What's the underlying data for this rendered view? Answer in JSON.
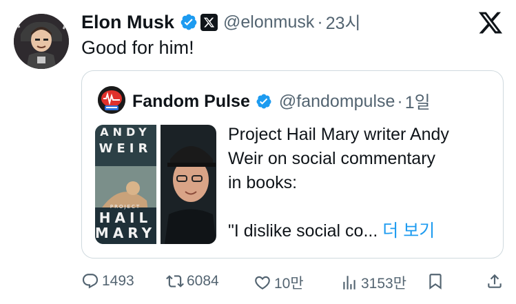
{
  "tweet": {
    "author_name": "Elon Musk",
    "handle": "@elonmusk",
    "separator": "·",
    "time": "23시",
    "text": "Good for him!"
  },
  "quote": {
    "author_name": "Fandom Pulse",
    "handle": "@fandompulse",
    "separator": "·",
    "time": "1일",
    "text_lines": [
      "Project Hail Mary writer Andy",
      "Weir on social commentary",
      "in books:"
    ],
    "text_continued": "\"I dislike social co...",
    "show_more": "더 보기",
    "media": {
      "book_cover_words": [
        "ANDY",
        "WEIR",
        "PROJECT",
        "HAIL",
        "MARY"
      ]
    }
  },
  "actions": {
    "replies": "1493",
    "reposts": "6084",
    "likes": "10만",
    "views": "3153만"
  },
  "colors": {
    "accent": "#1d9bf0",
    "secondary_text": "#536471",
    "border": "#cfd9de"
  },
  "icons": [
    "verified-icon",
    "x-badge-icon",
    "x-logo-icon",
    "reply-icon",
    "repost-icon",
    "like-icon",
    "views-icon",
    "bookmark-icon",
    "share-icon"
  ]
}
